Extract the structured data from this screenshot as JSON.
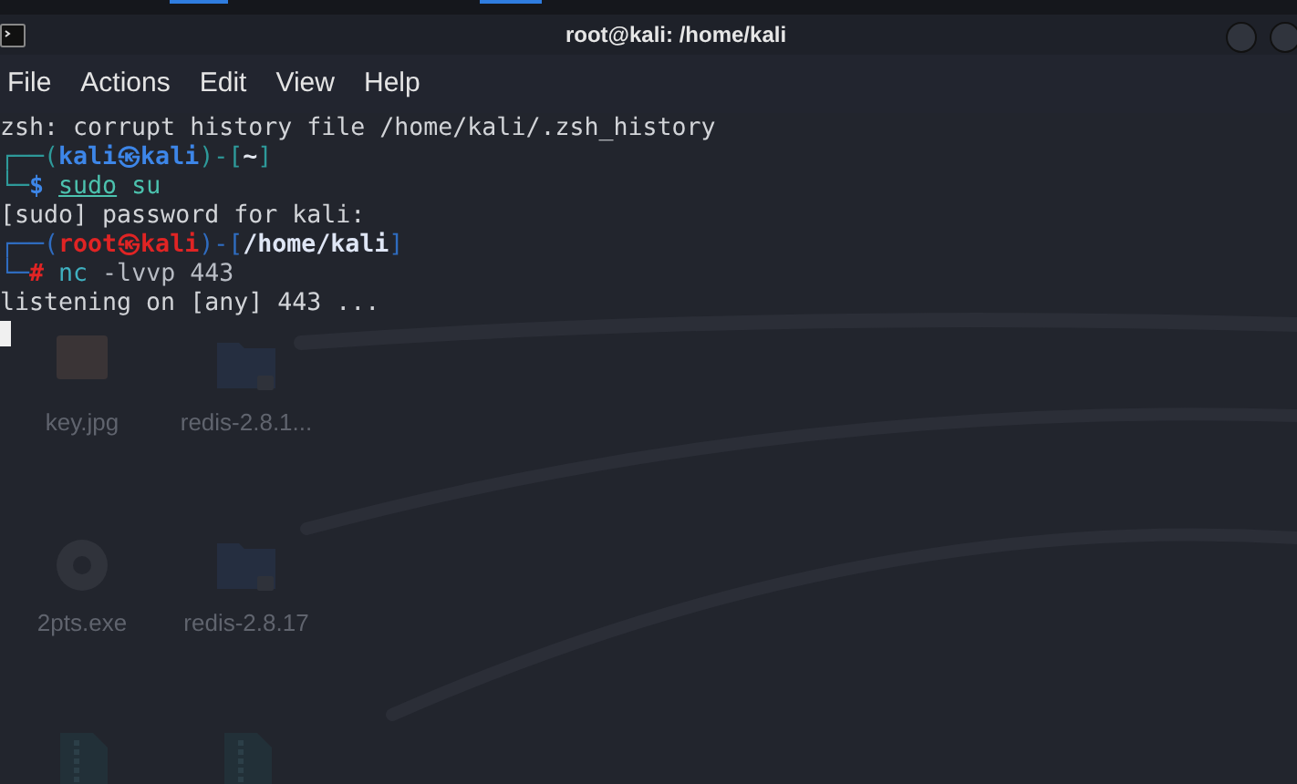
{
  "window": {
    "title": "root@kali: /home/kali"
  },
  "menu": [
    "File",
    "Actions",
    "Edit",
    "View",
    "Help"
  ],
  "terminal": {
    "lines": [
      [
        {
          "text": "zsh: corrupt history file /home/kali/.zsh_history",
          "color": "#d2d4d8"
        }
      ],
      [
        {
          "text": "┌──(",
          "color": "#2e9a9a"
        },
        {
          "text": "kali㉿kali",
          "color": "#3d86e8",
          "bold": true
        },
        {
          "text": ")-[",
          "color": "#2e9a9a"
        },
        {
          "text": "~",
          "color": "#e4e8f0",
          "bold": true
        },
        {
          "text": "]",
          "color": "#2e9a9a"
        }
      ],
      [
        {
          "text": "└─",
          "color": "#2e9a9a"
        },
        {
          "text": "$ ",
          "color": "#3d86e8",
          "bold": true
        },
        {
          "text": "sudo",
          "color": "#4cc2ae",
          "underline": true
        },
        {
          "text": " su",
          "color": "#4cc2ae"
        }
      ],
      [
        {
          "text": "[sudo] password for kali:",
          "color": "#d2d4d8"
        }
      ],
      [
        {
          "text": "┌──(",
          "color": "#2f6cc0"
        },
        {
          "text": "root㉿kali",
          "color": "#e02424",
          "bold": true
        },
        {
          "text": ")-[",
          "color": "#2f6cc0"
        },
        {
          "text": "/home/kali",
          "color": "#dfe6f5",
          "bold": true
        },
        {
          "text": "]",
          "color": "#2f6cc0"
        }
      ],
      [
        {
          "text": "└─",
          "color": "#2f6cc0"
        },
        {
          "text": "# ",
          "color": "#e02424",
          "bold": true
        },
        {
          "text": "nc",
          "color": "#3fb0c0"
        },
        {
          "text": " -lvvp 443",
          "color": "#b8bcc4"
        }
      ],
      [
        {
          "text": "listening on [any] 443 ...",
          "color": "#d2d4d8"
        }
      ]
    ]
  },
  "desktop_icons": [
    {
      "label": "key.jpg",
      "kind": "image"
    },
    {
      "label": "redis-2.8.1...",
      "kind": "folder"
    },
    {
      "label": "2pts.exe",
      "kind": "gear"
    },
    {
      "label": "redis-2.8.17",
      "kind": "folder"
    },
    {
      "kind": "zip"
    },
    {
      "kind": "zip"
    }
  ]
}
